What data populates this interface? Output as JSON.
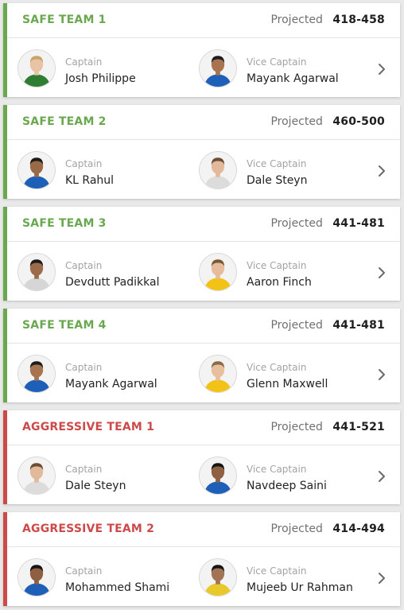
{
  "colors": {
    "safe": "#6aa84f",
    "aggressive": "#cc4a4a"
  },
  "teams": [
    {
      "name": "SAFE TEAM 1",
      "kind": "safe",
      "projected_label": "Projected",
      "projected_range": "418-458",
      "captain": {
        "role": "Captain",
        "name": "Josh Philippe",
        "jersey": "#2e7d32",
        "skin": "#e8c3a6",
        "hair": "#c9a46a"
      },
      "vice_captain": {
        "role": "Vice Captain",
        "name": "Mayank Agarwal",
        "jersey": "#1e5fb8",
        "skin": "#a8744f",
        "hair": "#1d1d1d"
      }
    },
    {
      "name": "SAFE TEAM 2",
      "kind": "safe",
      "projected_label": "Projected",
      "projected_range": "460-500",
      "captain": {
        "role": "Captain",
        "name": "KL Rahul",
        "jersey": "#1e5fb8",
        "skin": "#9a6a48",
        "hair": "#1a1a1a"
      },
      "vice_captain": {
        "role": "Vice Captain",
        "name": "Dale Steyn",
        "jersey": "#dcdcdc",
        "skin": "#e2b99b",
        "hair": "#6b4e33"
      }
    },
    {
      "name": "SAFE TEAM 3",
      "kind": "safe",
      "projected_label": "Projected",
      "projected_range": "441-481",
      "captain": {
        "role": "Captain",
        "name": "Devdutt Padikkal",
        "jersey": "#d6d6d6",
        "skin": "#9b6b4a",
        "hair": "#1c1c1c"
      },
      "vice_captain": {
        "role": "Vice Captain",
        "name": "Aaron Finch",
        "jersey": "#f2c316",
        "skin": "#e6bd9c",
        "hair": "#7a5a36"
      }
    },
    {
      "name": "SAFE TEAM 4",
      "kind": "safe",
      "projected_label": "Projected",
      "projected_range": "441-481",
      "captain": {
        "role": "Captain",
        "name": "Mayank Agarwal",
        "jersey": "#1e5fb8",
        "skin": "#a8744f",
        "hair": "#1d1d1d"
      },
      "vice_captain": {
        "role": "Vice Captain",
        "name": "Glenn Maxwell",
        "jersey": "#f2c316",
        "skin": "#e7bf9f",
        "hair": "#8a6a45"
      }
    },
    {
      "name": "AGGRESSIVE TEAM 1",
      "kind": "aggressive",
      "projected_label": "Projected",
      "projected_range": "441-521",
      "captain": {
        "role": "Captain",
        "name": "Dale Steyn",
        "jersey": "#dcdcdc",
        "skin": "#e2b99b",
        "hair": "#6b4e33"
      },
      "vice_captain": {
        "role": "Vice Captain",
        "name": "Navdeep Saini",
        "jersey": "#1e5fb8",
        "skin": "#8f6042",
        "hair": "#151515"
      }
    },
    {
      "name": "AGGRESSIVE TEAM 2",
      "kind": "aggressive",
      "projected_label": "Projected",
      "projected_range": "414-494",
      "captain": {
        "role": "Captain",
        "name": "Mohammed Shami",
        "jersey": "#1e5fb8",
        "skin": "#8e5f40",
        "hair": "#161616"
      },
      "vice_captain": {
        "role": "Vice Captain",
        "name": "Mujeeb Ur Rahman",
        "jersey": "#e8c82a",
        "skin": "#a27354",
        "hair": "#151515"
      }
    }
  ],
  "icons": {
    "avatar": "player-avatar-icon",
    "open": "chevron-right-icon"
  }
}
